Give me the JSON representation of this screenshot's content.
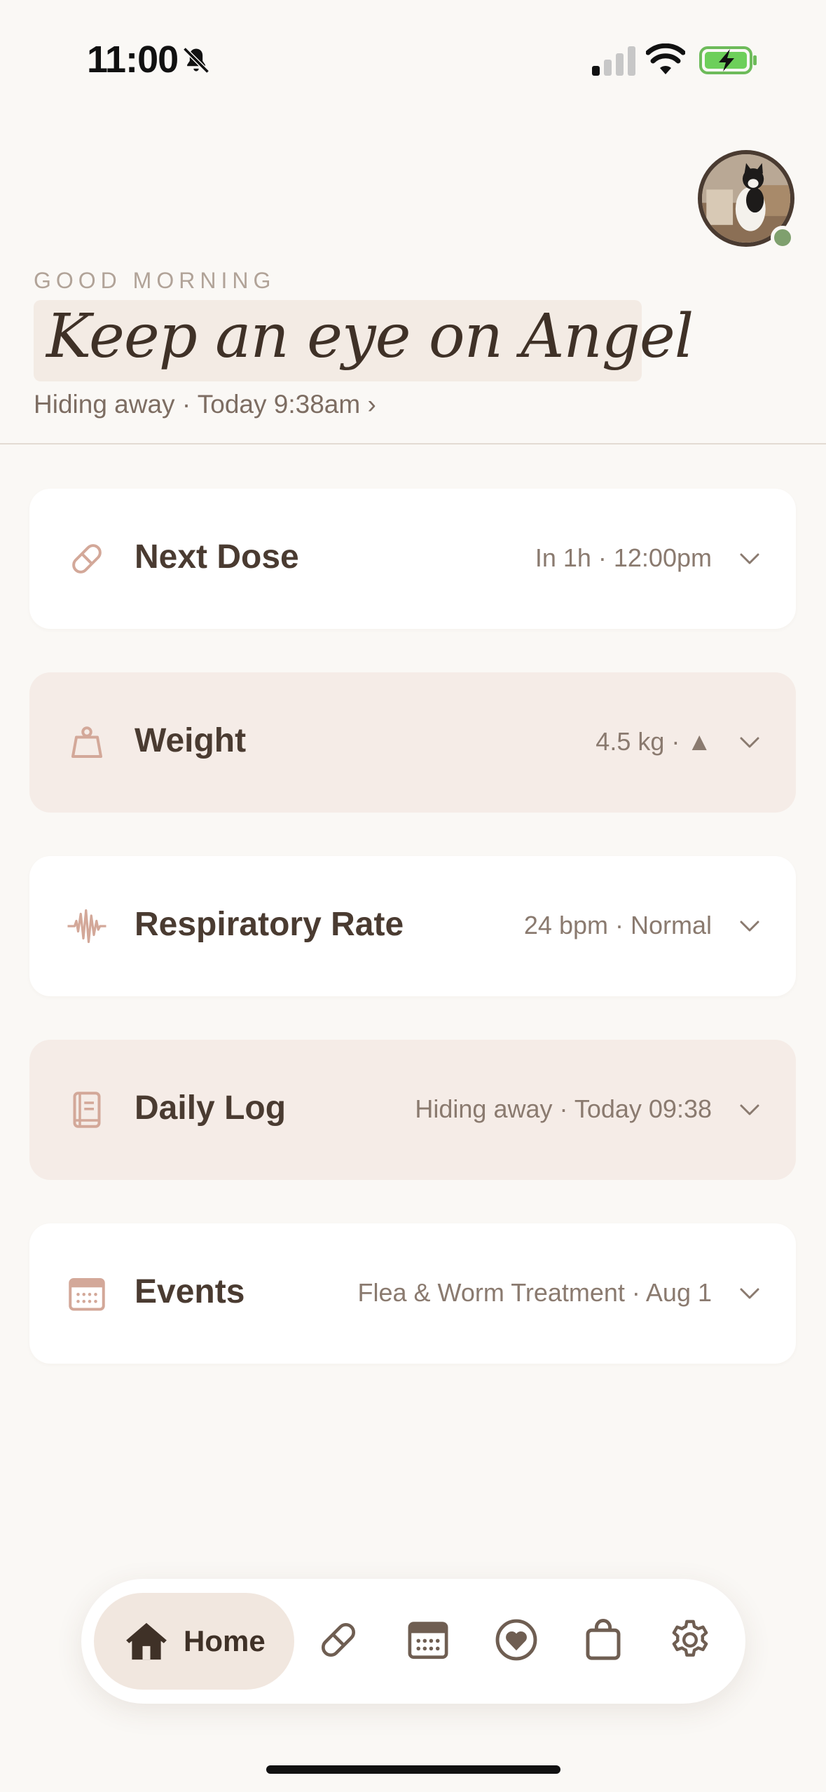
{
  "status_bar": {
    "time": "11:00"
  },
  "header": {
    "greeting": "GOOD MORNING",
    "headline": "Keep an eye on Angel",
    "subline": "Hiding away · Today 9:38am ›"
  },
  "cards": [
    {
      "title": "Next Dose",
      "info": "In 1h · 12:00pm",
      "icon": "pill-icon"
    },
    {
      "title": "Weight",
      "info": "4.5 kg · ▲",
      "icon": "scale-icon"
    },
    {
      "title": "Respiratory Rate",
      "info": "24 bpm · Normal",
      "icon": "waveform-icon"
    },
    {
      "title": "Daily Log",
      "info": "Hiding away · Today 09:38",
      "icon": "book-icon"
    },
    {
      "title": "Events",
      "info": "Flea & Worm Treatment  · Aug 1",
      "icon": "calendar-icon"
    }
  ],
  "tabbar": {
    "home_label": "Home",
    "icons": [
      "home-icon",
      "pill-icon",
      "calendar-icon",
      "heart-icon",
      "bag-icon",
      "gear-icon"
    ]
  },
  "colors": {
    "background": "#faf8f5",
    "accent_text": "#4a3b31",
    "icon_tint": "#d3a899",
    "pink_card": "#f5ece7",
    "online": "#7fa06e"
  }
}
